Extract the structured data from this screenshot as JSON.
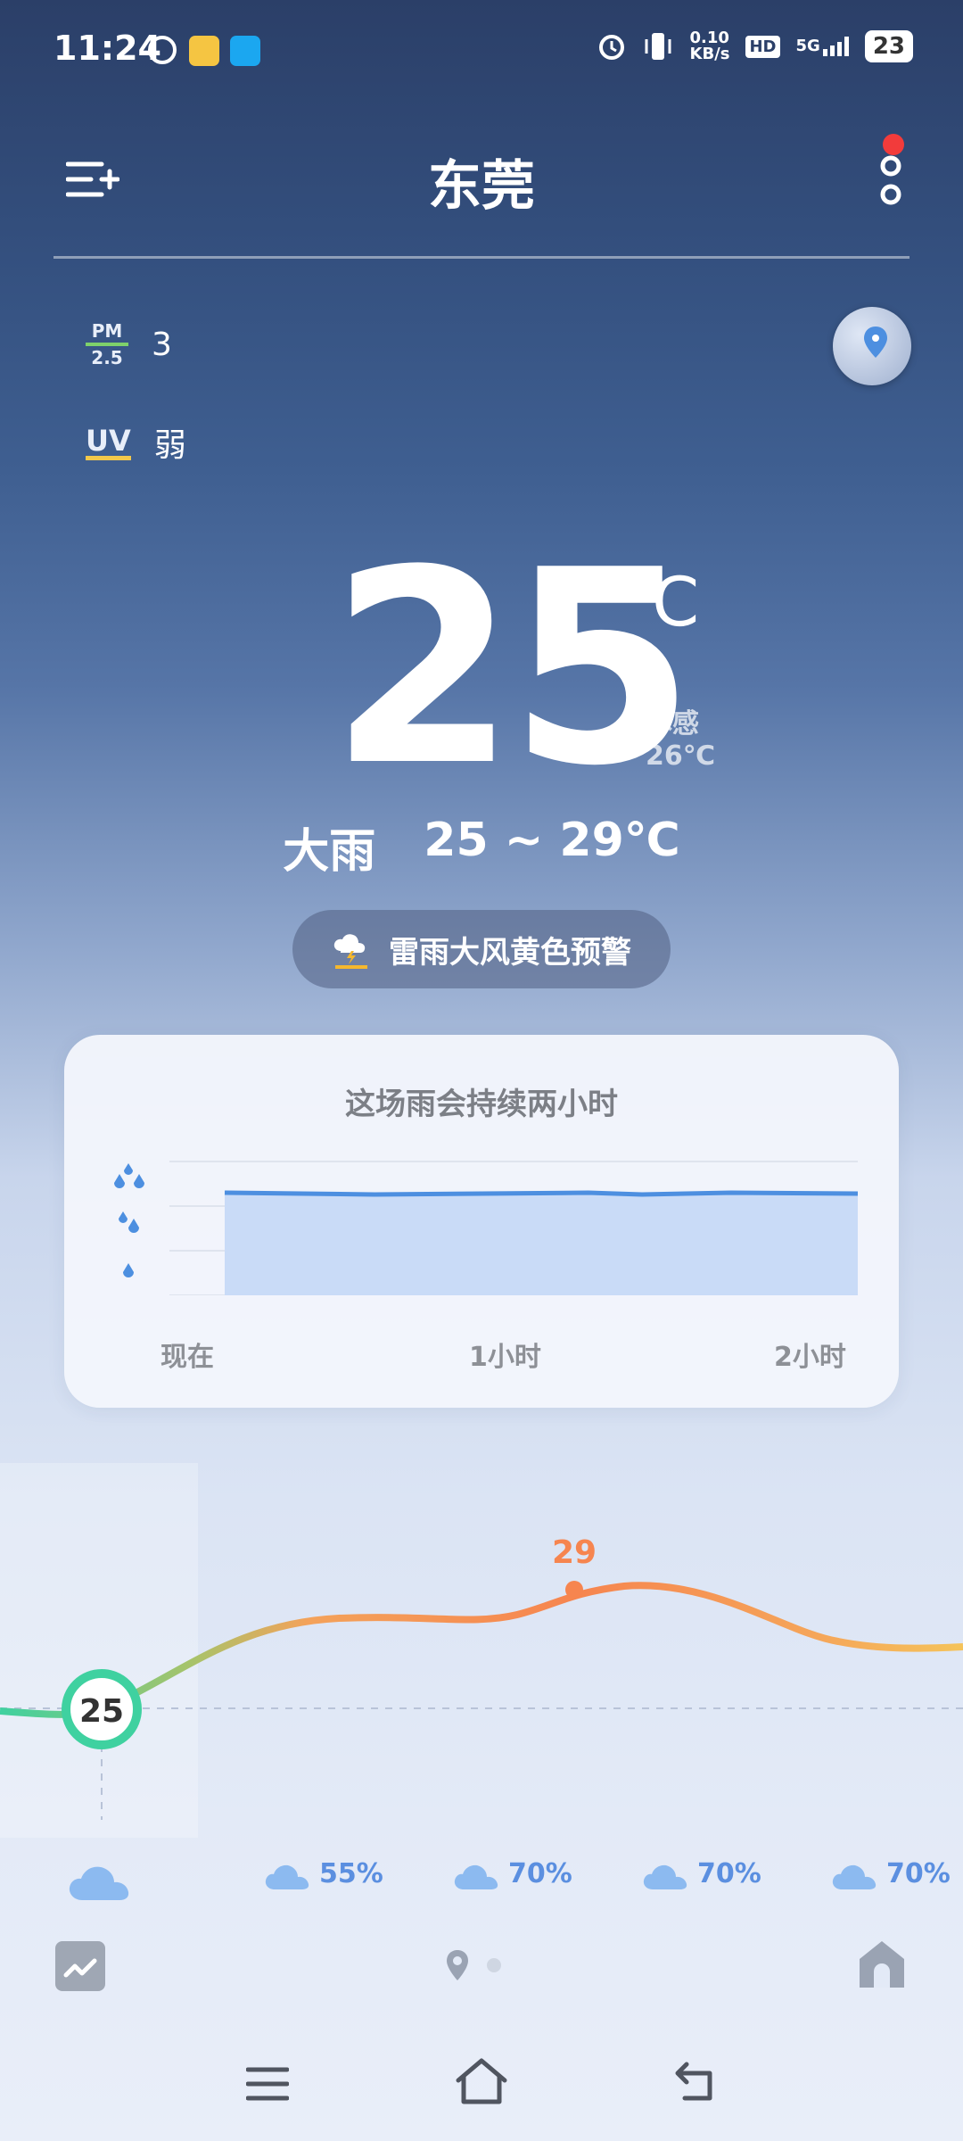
{
  "status_bar": {
    "time": "11:24",
    "speed": "0.10",
    "speed_unit": "KB/s",
    "network": "5G",
    "hd": "HD",
    "battery": "23"
  },
  "header": {
    "city": "东莞"
  },
  "indicators": {
    "pm_label_top": "PM",
    "pm_label_bottom": "2.5",
    "pm_value": "3",
    "uv_label": "UV",
    "uv_value": "弱"
  },
  "current": {
    "temperature": "25",
    "unit": "℃",
    "feels_label": "体感",
    "feels_value": "26℃",
    "condition": "大雨",
    "range": "25 ~ 29℃"
  },
  "alert": {
    "text": "雷雨大风黄色预警"
  },
  "rain_card": {
    "title": "这场雨会持续两小时",
    "x_labels": [
      "现在",
      "1小时",
      "2小时"
    ]
  },
  "hourly": {
    "current_temp": "25",
    "max_temp": "29",
    "precip": [
      "55%",
      "70%",
      "70%",
      "70%"
    ]
  },
  "colors": {
    "accent_green": "#3fd1a0",
    "accent_orange": "#f6854f",
    "rain_blue": "#4d8fe0",
    "alert_red": "#f23b3b"
  }
}
